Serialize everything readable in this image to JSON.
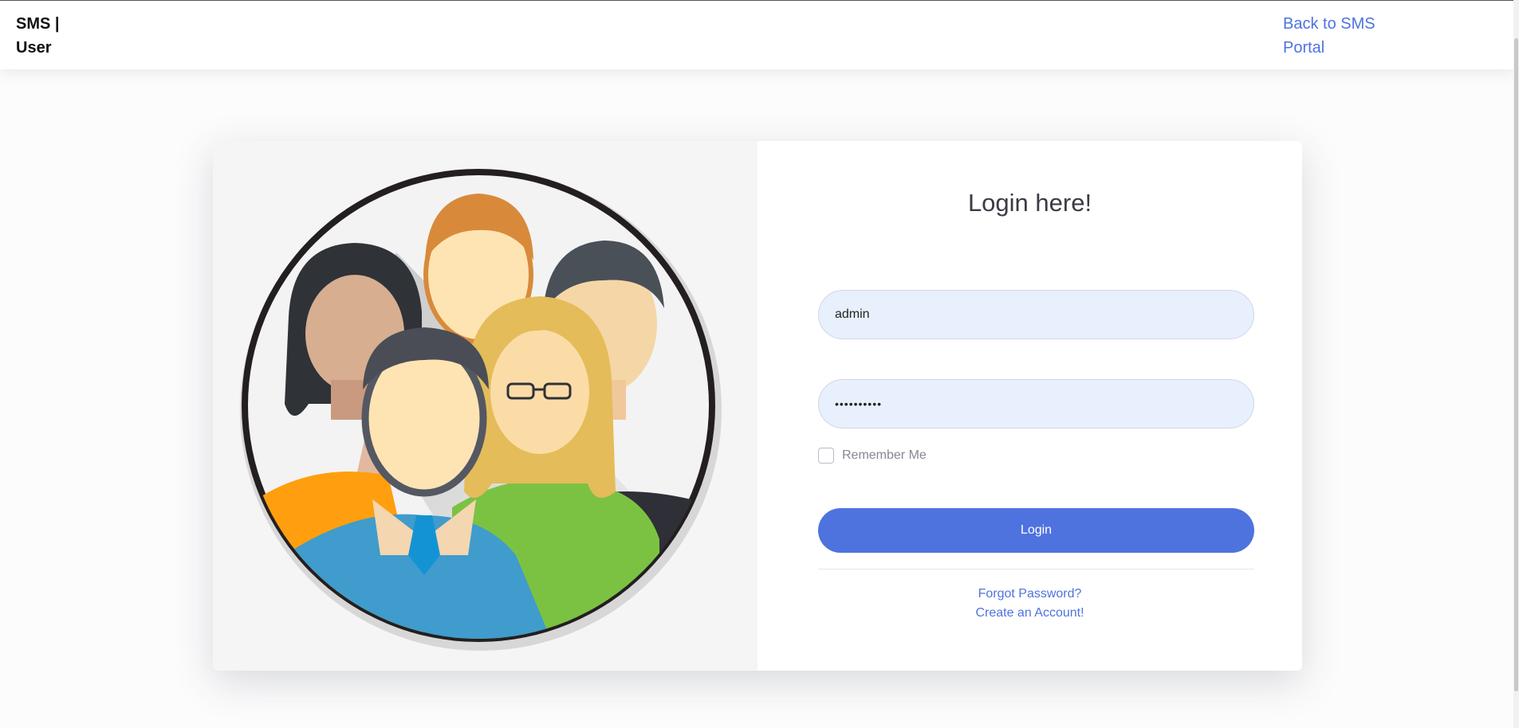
{
  "header": {
    "brand_line1": "SMS |",
    "brand_line2": "User",
    "back_link_line1": "Back to SMS",
    "back_link_line2": "Portal"
  },
  "login": {
    "title": "Login here!",
    "username_value": "admin",
    "password_value": "••••••••••",
    "remember_label": "Remember Me",
    "remember_checked": false,
    "login_button": "Login",
    "forgot_link": "Forgot Password?",
    "create_link": "Create an Account!"
  },
  "illustration": {
    "icon": "user-group-avatars-illustration"
  },
  "colors": {
    "primary": "#4e73df",
    "input_bg": "#e8f0fe",
    "muted_text": "#858796"
  }
}
